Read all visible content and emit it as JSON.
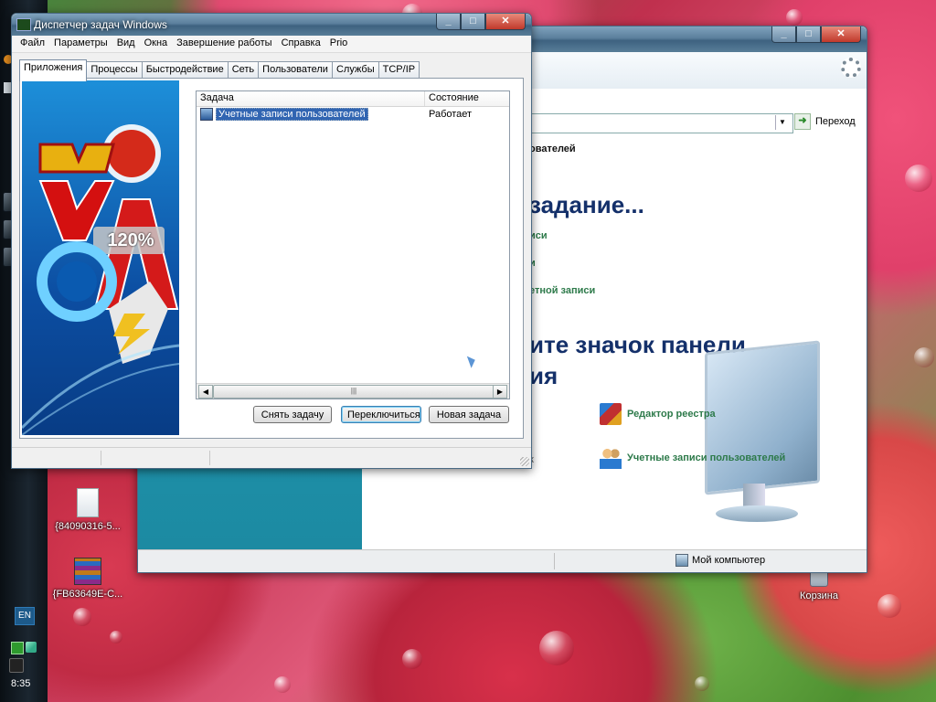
{
  "desktop": {
    "icons": [
      {
        "label": "{84090316-5..."
      },
      {
        "label": "{FB63649E-C..."
      },
      {
        "label": "Корзина"
      }
    ]
  },
  "taskbar": {
    "language": "EN",
    "clock": "8:35"
  },
  "explorer_window": {
    "go_label": "Переход",
    "breadcrumb_fragment": "ователей",
    "task_heading": "задание...",
    "task_links": [
      "иси",
      "и",
      "етной записи"
    ],
    "panel_heading_line1": "ите значок панели",
    "panel_heading_line2": "ия",
    "items": [
      {
        "label": "Редактор реестра",
        "icon": "registry-editor-icon"
      },
      {
        "label": "Учетные записи пользователей",
        "icon": "user-accounts-icon"
      }
    ],
    "left_fragment": "к",
    "status_text": "Мой компьютер"
  },
  "task_manager": {
    "title": "Диспетчер задач Windows",
    "menu": [
      "Файл",
      "Параметры",
      "Вид",
      "Окна",
      "Завершение работы",
      "Справка",
      "Prio"
    ],
    "tabs": [
      "Приложения",
      "Процессы",
      "Быстродействие",
      "Сеть",
      "Пользователи",
      "Службы",
      "TCP/IP"
    ],
    "active_tab": "Приложения",
    "art_badge": "120%",
    "columns": [
      "Задача",
      "Состояние"
    ],
    "rows": [
      {
        "task": "Учетные записи пользователей",
        "status": "Работает"
      }
    ],
    "buttons": {
      "end_task": "Снять задачу",
      "switch_to": "Переключиться",
      "new_task": "Новая задача"
    }
  }
}
